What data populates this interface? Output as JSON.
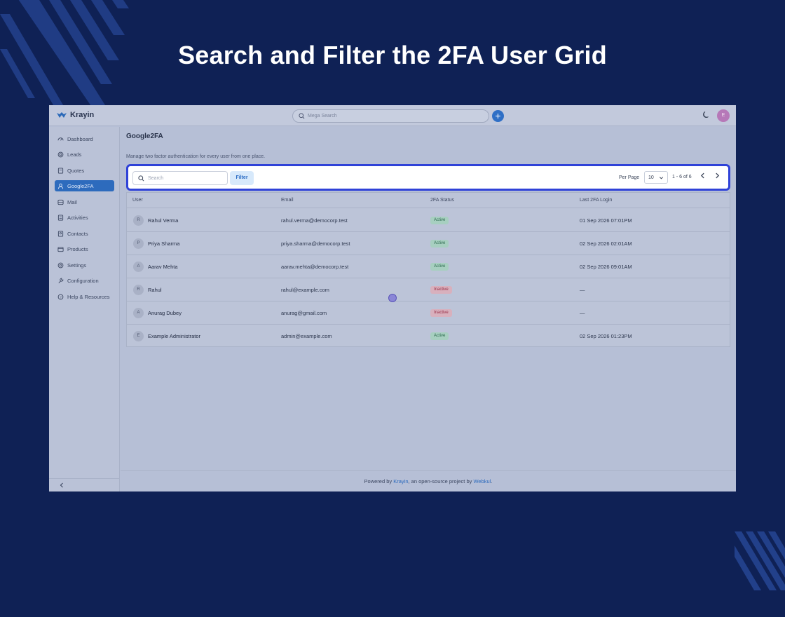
{
  "headline": "Search and Filter the 2FA User Grid",
  "app": {
    "brand": "Krayin",
    "mega_search_placeholder": "Mega Search",
    "avatar_initial": "E",
    "colors": {
      "accent": "#2d6bbd",
      "highlight": "#2f42d8",
      "background": "#0f2155"
    }
  },
  "sidebar": {
    "items": [
      {
        "label": "Dashboard",
        "icon": "dashboard-icon"
      },
      {
        "label": "Leads",
        "icon": "leads-icon"
      },
      {
        "label": "Quotes",
        "icon": "quotes-icon"
      },
      {
        "label": "Google2FA",
        "icon": "user-icon",
        "active": true
      },
      {
        "label": "Mail",
        "icon": "mail-icon"
      },
      {
        "label": "Activities",
        "icon": "activities-icon"
      },
      {
        "label": "Contacts",
        "icon": "contacts-icon"
      },
      {
        "label": "Products",
        "icon": "products-icon"
      },
      {
        "label": "Settings",
        "icon": "settings-icon"
      },
      {
        "label": "Configuration",
        "icon": "wrench-icon"
      },
      {
        "label": "Help & Resources",
        "icon": "help-icon"
      }
    ]
  },
  "page": {
    "title": "Google2FA",
    "subtitle": "Manage two factor authentication for every user from one place."
  },
  "toolbar": {
    "search_placeholder": "Search",
    "filter_label": "Filter",
    "per_page_label": "Per Page",
    "per_page_value": "10",
    "range": "1 - 6 of 6"
  },
  "table": {
    "columns": [
      "User",
      "Email",
      "2FA Status",
      "Last 2FA Login"
    ],
    "rows": [
      {
        "initial": "R",
        "name": "Rahul Verma",
        "email": "rahul.verma@democorp.test",
        "status": "Active",
        "last": "01 Sep 2026 07:01PM"
      },
      {
        "initial": "P",
        "name": "Priya Sharma",
        "email": "priya.sharma@democorp.test",
        "status": "Active",
        "last": "02 Sep 2026 02:01AM"
      },
      {
        "initial": "A",
        "name": "Aarav Mehta",
        "email": "aarav.mehta@democorp.test",
        "status": "Active",
        "last": "02 Sep 2026 09:01AM"
      },
      {
        "initial": "R",
        "name": "Rahul",
        "email": "rahul@example.com",
        "status": "Inactive",
        "last": "—"
      },
      {
        "initial": "A",
        "name": "Anurag Dubey",
        "email": "anurag@gmail.com",
        "status": "Inactive",
        "last": "—"
      },
      {
        "initial": "E",
        "name": "Example Administrator",
        "email": "admin@example.com",
        "status": "Active",
        "last": "02 Sep 2026 01:23PM"
      }
    ]
  },
  "footer": {
    "prefix": "Powered by ",
    "link1": "Krayin",
    "middle": ", an open-source project by ",
    "link2": "Webkul",
    "suffix": "."
  }
}
